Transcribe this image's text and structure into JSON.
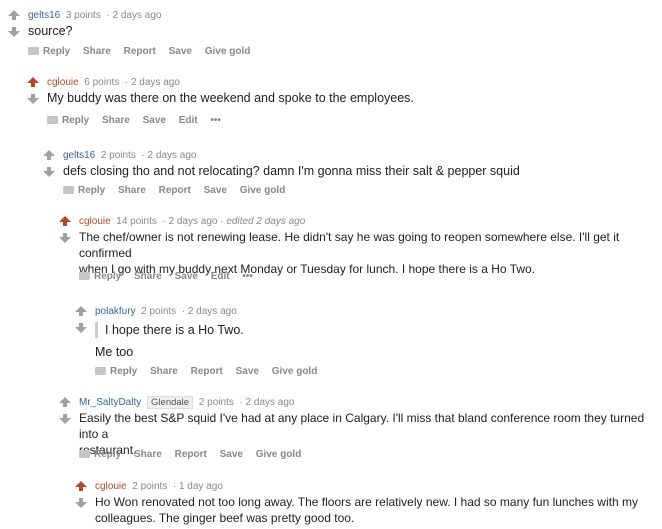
{
  "colors": {
    "upvote": "#b04a2a",
    "downvote": "#a0a0a0",
    "link": "#336699"
  },
  "comments": [
    {
      "author": "gelts16",
      "points": "3 points",
      "time": "2 days ago",
      "body": [
        "source?"
      ],
      "actions": [
        "Reply",
        "Share",
        "Report",
        "Save",
        "Give gold"
      ]
    },
    {
      "author": "cglouie",
      "points": "6 points",
      "time": "2 days ago",
      "body": [
        "My buddy was there on the weekend and spoke to the employees."
      ],
      "actions": [
        "Reply",
        "Share",
        "Save",
        "Edit",
        "•••"
      ]
    },
    {
      "author": "gelts16",
      "points": "2 points",
      "time": "2 days ago",
      "body": [
        "defs closing tho and not relocating? damn I'm gonna miss their salt & pepper squid"
      ],
      "actions": [
        "Reply",
        "Share",
        "Report",
        "Save",
        "Give gold"
      ]
    },
    {
      "author": "cglouie",
      "points": "14 points",
      "time": "2 days ago",
      "edited": "· edited 2 days ago",
      "body": [
        "The chef/owner is not renewing lease. He didn't say he was going to reopen somewhere else. I'll get it confirmed",
        "when I go with my buddy next Monday or Tuesday for lunch. I hope there is a Ho Two."
      ],
      "actions": [
        "Reply",
        "Share",
        "Save",
        "Edit",
        "•••"
      ]
    },
    {
      "author": "polakfury",
      "points": "2 points",
      "time": "2 days ago",
      "quote": "I hope there is a Ho Two.",
      "body": [
        "Me too"
      ],
      "actions": [
        "Reply",
        "Share",
        "Report",
        "Save",
        "Give gold"
      ]
    },
    {
      "author": "Mr_SaltyDalty",
      "flair": "Glendale",
      "points": "2 points",
      "time": "2 days ago",
      "body": [
        "Easily the best S&P squid I've had at any place in Calgary. I'll miss that bland conference room they turned into a",
        "restaurant."
      ],
      "actions": [
        "Reply",
        "Share",
        "Report",
        "Save",
        "Give gold"
      ]
    },
    {
      "author": "cglouie",
      "points": "2 points",
      "time": "1 day ago",
      "body": [
        "Ho Won renovated not too long away. The floors are relatively new. I had so many fun lunches with my",
        "colleagues. The ginger beef was pretty good too."
      ],
      "actions": []
    }
  ]
}
